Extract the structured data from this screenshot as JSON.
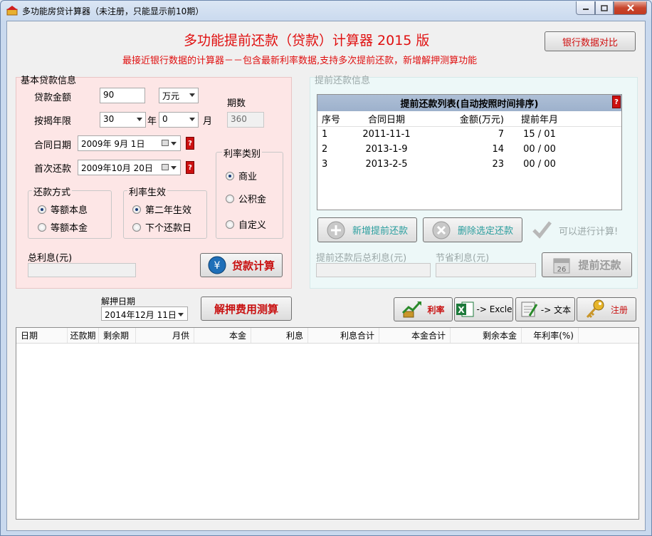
{
  "window": {
    "title": "多功能房贷计算器（未注册，只能显示前10期）"
  },
  "header": {
    "main_title": "多功能提前还款（贷款）计算器 2015 版",
    "subtitle": "最接近银行数据的计算器－－包含最新利率数据,支持多次提前还款，新增解押测算功能",
    "bank_compare_label": "银行数据对比"
  },
  "basic": {
    "group_title": "基本贷款信息",
    "amount_label": "贷款金额",
    "amount_value": "90",
    "amount_unit": "万元",
    "period_label": "期数",
    "years_label": "按揭年限",
    "years_value": "30",
    "years_unit": "年",
    "months_value": "0",
    "months_unit": "月",
    "period_value": "360",
    "contract_date_label": "合同日期",
    "contract_date_value": "2009年  9月   1日",
    "first_pay_label": "首次还款",
    "first_pay_value": "2009年10月  20日",
    "repay_method_title": "还款方式",
    "method_equal_payment": "等额本息",
    "method_equal_principal": "等额本金",
    "rate_effect_title": "利率生效",
    "effect_second_year": "第二年生效",
    "effect_next_payment": "下个还款日",
    "rate_type_title": "利率类别",
    "rate_commercial": "商业",
    "rate_fund": "公积金",
    "rate_custom": "自定义",
    "total_interest_label": "总利息(元)",
    "total_interest_value": "",
    "calc_button": "贷款计算"
  },
  "prepay": {
    "group_title": "提前还款信息",
    "list_title": "提前还款列表(自动按照时间排序)",
    "columns": [
      "序号",
      "合同日期",
      "金额(万元)",
      "提前年月"
    ],
    "rows": [
      {
        "no": "1",
        "date": "2011-11-1",
        "amount": "7",
        "ym": "15 / 01"
      },
      {
        "no": "2",
        "date": "2013-1-9",
        "amount": "14",
        "ym": "00 / 00"
      },
      {
        "no": "3",
        "date": "2013-2-5",
        "amount": "23",
        "ym": "00 / 00"
      }
    ],
    "add_button": "新增提前还款",
    "delete_button": "删除选定还款",
    "ready_text": "可以进行计算!",
    "after_interest_label": "提前还款后总利息(元)",
    "save_interest_label": "节省利息(元)",
    "prepay_button": "提前还款",
    "calendar_day": "26"
  },
  "release": {
    "date_label": "解押日期",
    "date_value": "2014年12月  11日",
    "calc_button": "解押费用测算"
  },
  "toolbar": {
    "rate_button": "利率",
    "excel_button": "-> Excle",
    "text_button": "-> 文本",
    "register_button": "注册"
  },
  "grid": {
    "columns": [
      "日期",
      "还款期",
      "剩余期",
      "月供",
      "本金",
      "利息",
      "利息合计",
      "本金合计",
      "剩余本金",
      "年利率(%)"
    ]
  },
  "colors": {
    "accent_red": "#e01010",
    "left_panel_bg": "#fde6e6",
    "right_panel_bg": "#edf8f8",
    "list_header_bg": "#aebfd6"
  }
}
